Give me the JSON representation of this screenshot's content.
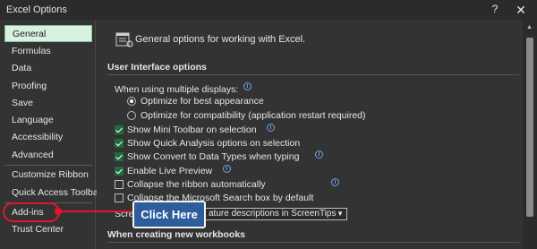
{
  "window": {
    "title": "Excel Options",
    "help_label": "?",
    "close_label": "✕"
  },
  "sidebar": {
    "items": [
      {
        "label": "General",
        "active": true
      },
      {
        "label": "Formulas"
      },
      {
        "label": "Data"
      },
      {
        "label": "Proofing"
      },
      {
        "label": "Save"
      },
      {
        "label": "Language"
      },
      {
        "label": "Accessibility"
      },
      {
        "label": "Advanced"
      },
      {
        "label": "Customize Ribbon"
      },
      {
        "label": "Quick Access Toolbar"
      },
      {
        "label": "Add-ins"
      },
      {
        "label": "Trust Center"
      }
    ]
  },
  "main": {
    "header": "General options for working with Excel.",
    "ui_section_title": "User Interface options",
    "multiple_displays_label": "When using multiple displays:",
    "info_glyph": "i",
    "radio_options": [
      {
        "label": "Optimize for best appearance",
        "selected": true
      },
      {
        "label": "Optimize for compatibility (application restart required)",
        "selected": false
      }
    ],
    "checkboxes": [
      {
        "label": "Show Mini Toolbar on selection",
        "checked": true
      },
      {
        "label": "Show Quick Analysis options on selection",
        "checked": true
      },
      {
        "label": "Show Convert to Data Types when typing",
        "checked": true
      },
      {
        "label": "Enable Live Preview",
        "checked": true
      },
      {
        "label": "Collapse the ribbon automatically",
        "checked": false
      },
      {
        "label": "Collapse the Microsoft Search box by default",
        "checked": false
      }
    ],
    "screentip": {
      "label_partial": "Scre",
      "value_partial": "ature descriptions in ScreenTips"
    },
    "new_workbooks_title": "When creating new workbooks"
  },
  "callout": {
    "text": "Click Here"
  },
  "colors": {
    "active_nav_bg": "#d9f1e1",
    "checkbox_checked": "#1e6b3e",
    "callout_bg": "#2e5d9c",
    "highlight_red": "#e8122d"
  }
}
